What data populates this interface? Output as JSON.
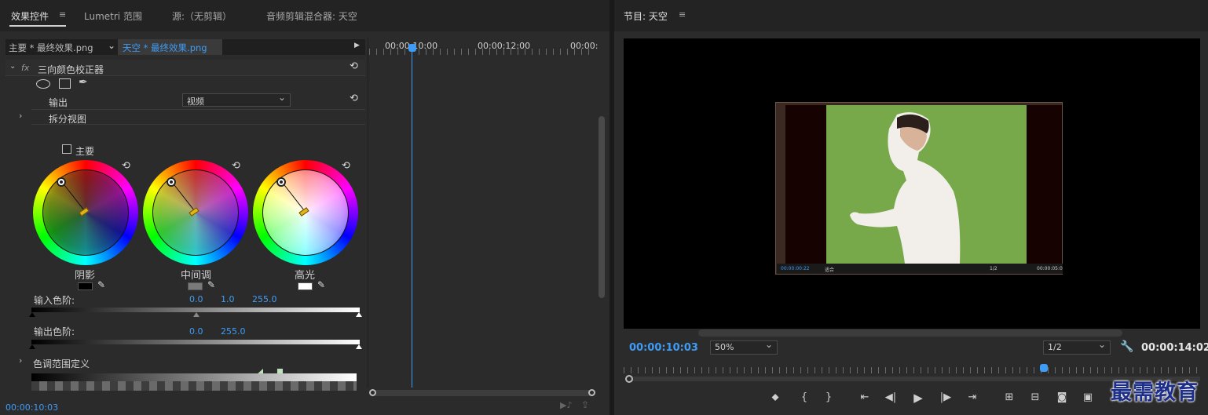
{
  "left_panel": {
    "tabs": [
      "效果控件",
      "Lumetri 范围",
      "源:（无剪辑）",
      "音频剪辑混合器: 天空"
    ],
    "clip_tabs": {
      "master": "主要 * 最终效果.png",
      "sequence": "天空 * 最终效果.png"
    },
    "effect": {
      "fx": "fx",
      "name": "三向颜色校正器",
      "output_label": "输出",
      "output_value": "视频",
      "split_view_label": "拆分视图",
      "master_label": "主要",
      "wheels": [
        {
          "label": "阴影",
          "swatch": "#000000"
        },
        {
          "label": "中间调",
          "swatch": "#7a7a7a"
        },
        {
          "label": "高光",
          "swatch": "#ffffff"
        }
      ],
      "input_levels_label": "输入色阶:",
      "input_levels": [
        "0.0",
        "1.0",
        "255.0"
      ],
      "output_levels_label": "输出色阶:",
      "output_levels": [
        "0.0",
        "255.0"
      ],
      "tonal_range_label": "色调范围定义"
    },
    "timeline": {
      "ticks": [
        "00:00:10:00",
        "00:00:12:00",
        "00:00:"
      ]
    },
    "footer_timecode": "00:00:10:03"
  },
  "right_panel": {
    "title": "节目: 天空",
    "current_timecode": "00:00:10:03",
    "zoom": "50%",
    "resolution": "1/2",
    "duration": "00:00:14:02",
    "inner_preview": {
      "timecode": "00:00:00:22",
      "fit": "适合",
      "res": "1/2",
      "time2": "00:00:05:0"
    }
  },
  "watermark": "最需教育",
  "colors": {
    "accent": "#3f9cf6",
    "background": "#232323",
    "panel": "#2b2b2b",
    "green_screen": "#77a94a"
  }
}
